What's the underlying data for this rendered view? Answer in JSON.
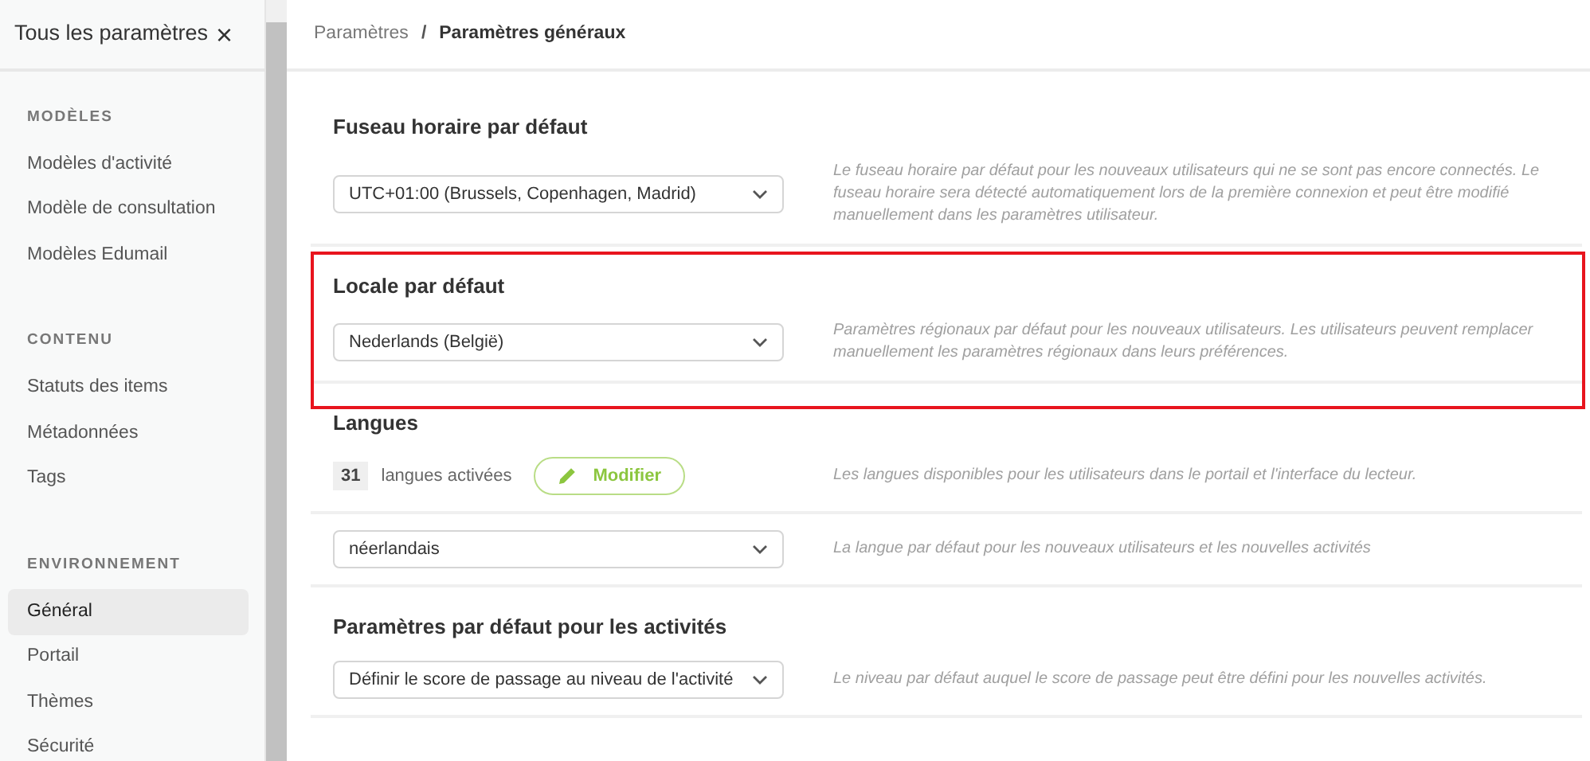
{
  "sidebar": {
    "title": "Tous les paramètres",
    "close": "×",
    "groups": [
      {
        "heading": "MODÈLES",
        "items": [
          {
            "label": "Modèles d'activité",
            "selected": false
          },
          {
            "label": "Modèle de consultation",
            "selected": false
          },
          {
            "label": "Modèles Edumail",
            "selected": false
          }
        ]
      },
      {
        "heading": "CONTENU",
        "items": [
          {
            "label": "Statuts des items",
            "selected": false
          },
          {
            "label": "Métadonnées",
            "selected": false
          },
          {
            "label": "Tags",
            "selected": false
          }
        ]
      },
      {
        "heading": "ENVIRONNEMENT",
        "items": [
          {
            "label": "Général",
            "selected": true
          },
          {
            "label": "Portail",
            "selected": false
          },
          {
            "label": "Thèmes",
            "selected": false
          },
          {
            "label": "Sécurité",
            "selected": false
          }
        ]
      }
    ]
  },
  "breadcrumb_separator": "/",
  "breadcrumb": [
    {
      "label": "Paramètres",
      "current": false
    },
    {
      "label": "Paramètres généraux",
      "current": true
    }
  ],
  "sections": [
    {
      "title": "Fuseau horaire par défaut",
      "highlighted": false,
      "rows": [
        {
          "kind": "select",
          "value": "UTC+01:00 (Brussels, Copenhagen, Madrid)",
          "description": "Le fuseau horaire par défaut pour les nouveaux utilisateurs qui ne se sont pas encore connectés. Le fuseau horaire sera détecté automatiquement lors de la première connexion et peut être modifié manuellement dans les paramètres utilisateur."
        }
      ]
    },
    {
      "title": "Locale par défaut",
      "highlighted": true,
      "rows": [
        {
          "kind": "select",
          "value": "Nederlands (België)",
          "description": "Paramètres régionaux par défaut pour les nouveaux utilisateurs. Les utilisateurs peuvent remplacer manuellement les paramètres régionaux dans leurs préférences."
        }
      ]
    },
    {
      "title": "Langues",
      "highlighted": false,
      "rows": [
        {
          "kind": "languages",
          "count": "31",
          "label": "langues activées",
          "button": "Modifier",
          "description": "Les langues disponibles pour les utilisateurs dans le portail et l'interface du lecteur."
        },
        {
          "kind": "select",
          "value": "néerlandais",
          "description": "La langue par défaut pour les nouveaux utilisateurs et les nouvelles activités"
        }
      ]
    },
    {
      "title": "Paramètres par défaut pour les activités",
      "highlighted": false,
      "rows": [
        {
          "kind": "select",
          "value": "Définir le score de passage au niveau de l'activité",
          "description": "Le niveau par défaut auquel le score de passage peut être défini pour les nouvelles activités."
        }
      ]
    }
  ]
}
